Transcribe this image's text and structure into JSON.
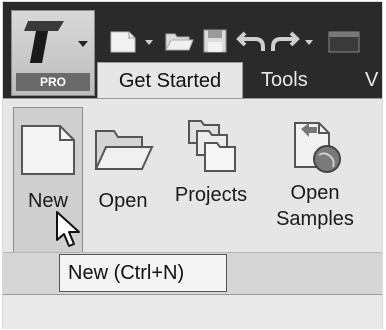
{
  "app": {
    "badge": "PRO",
    "logo_icon": "inventor-logo-icon"
  },
  "quick_access": {
    "icons": [
      "new-file-icon",
      "dropdown-arrow-icon",
      "open-folder-icon",
      "save-icon",
      "undo-icon",
      "redo-icon"
    ]
  },
  "tabs": [
    {
      "label": "Get Started",
      "active": true
    },
    {
      "label": "Tools",
      "active": false
    },
    {
      "label": "V",
      "active": false
    }
  ],
  "ribbon": {
    "buttons": [
      {
        "label": "New",
        "icon": "new-document-icon",
        "highlighted": true
      },
      {
        "label": "Open",
        "icon": "open-folder-icon"
      },
      {
        "label": "Projects",
        "icon": "projects-icon"
      },
      {
        "label_line1": "Open",
        "label_line2": "Samples",
        "icon": "open-samples-icon"
      }
    ]
  },
  "tooltip": {
    "text": "New (Ctrl+N)"
  },
  "colors": {
    "toolbar_dark": "#2a2a2a",
    "ribbon_bg": "#e6e6e6",
    "tooltip_bg": "#f4f4f4"
  }
}
